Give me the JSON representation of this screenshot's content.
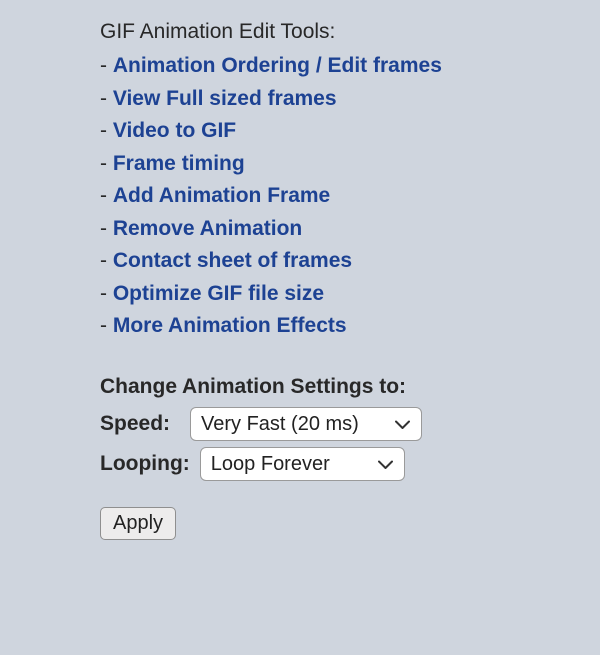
{
  "tools": {
    "heading": "GIF Animation Edit Tools:",
    "items": [
      {
        "label": "Animation Ordering / Edit frames"
      },
      {
        "label": "View Full sized frames"
      },
      {
        "label": "Video to GIF"
      },
      {
        "label": "Frame timing"
      },
      {
        "label": "Add Animation Frame"
      },
      {
        "label": "Remove Animation"
      },
      {
        "label": "Contact sheet of frames"
      },
      {
        "label": "Optimize GIF file size"
      },
      {
        "label": "More Animation Effects"
      }
    ]
  },
  "settings": {
    "heading": "Change Animation Settings to:",
    "speed_label": "Speed:",
    "speed_value": "Very Fast (20 ms)",
    "looping_label": "Looping:",
    "looping_value": "Loop Forever"
  },
  "actions": {
    "apply_label": "Apply"
  }
}
